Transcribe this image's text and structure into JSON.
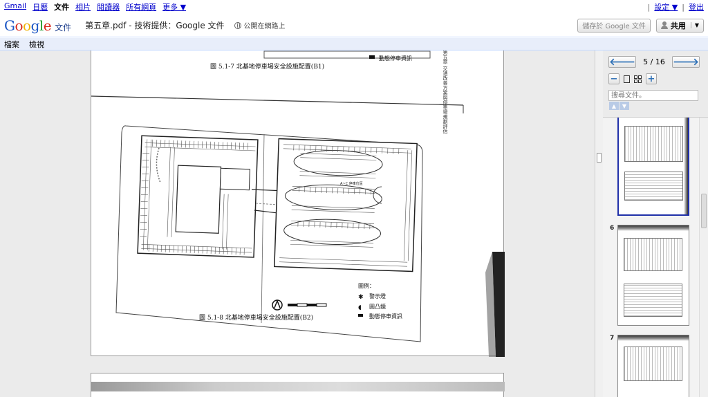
{
  "gbar": {
    "links": [
      "Gmail",
      "日曆",
      "文件",
      "相片",
      "閱讀器",
      "所有網頁",
      "更多 ▼"
    ],
    "current_index": 2,
    "settings": "設定 ▼",
    "signout": "登出",
    "separator": "|"
  },
  "header": {
    "logo_text": "Google",
    "product": "文件",
    "doc_title": "第五章.pdf - 技術提供：Google 文件",
    "shared_status": "公開在網路上",
    "save_button": "儲存於 Google 文件",
    "share_button": "共用"
  },
  "menu": [
    "檔案",
    "檢視"
  ],
  "viewer": {
    "top_caption": "圖 5.1-7  北基地停車場安全設施配置(B1)",
    "top_legend": "動態停車資訊",
    "caption": "圖 5.1-8  北基地停車場安全設施配置(B2)",
    "legend_title": "圖例：",
    "legend_items": [
      "警示燈",
      "圓凸鏡",
      "動態停車資訊"
    ],
    "area_label": "A~C 停車位區",
    "side_text": "第五章  交通改善方案與停車場規劃評估"
  },
  "panel": {
    "prev_icon": "arrow-left-icon",
    "next_icon": "arrow-right-icon",
    "page_indicator": "5 / 16",
    "zoom_out": "−",
    "zoom_in": "+",
    "search_placeholder": "搜尋文件。",
    "thumbs": [
      {
        "num": "6"
      },
      {
        "num": "7"
      }
    ]
  },
  "colors": {
    "link": "#0000cc",
    "accent": "#2c6fb6",
    "menubar_bg": "#e8eefa",
    "selected_thumb": "#1f2fa8"
  }
}
